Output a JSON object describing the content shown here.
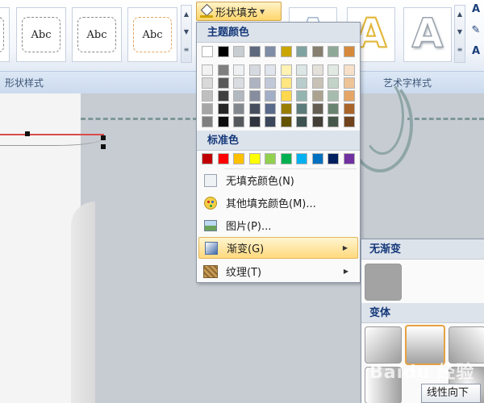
{
  "ribbon": {
    "shape_styles_label": "形状样式",
    "wordart_styles_label": "艺术字样式",
    "shape_fill_label": "形状填充",
    "style_sample_text": "Abc",
    "wordart_glyph": "A",
    "right_tool_glyphs": [
      "A",
      "✎",
      "A"
    ]
  },
  "menu": {
    "theme_colors_header": "主题颜色",
    "standard_colors_header": "标准色",
    "theme_top_row": [
      "#ffffff",
      "#000000",
      "#c8cdd2",
      "#5f6a7e",
      "#7e8ca6",
      "#c9a600",
      "#7fa3a1",
      "#877f6f",
      "#8ea896",
      "#d6893c"
    ],
    "theme_shades": [
      [
        "#f2f2f2",
        "#7f7f7f",
        "#eef0f2",
        "#d6d9df",
        "#e0e4ed",
        "#fff2b3",
        "#dbe6e5",
        "#e3e0da",
        "#e1e9e3",
        "#f6e0c9"
      ],
      [
        "#d9d9d9",
        "#595959",
        "#d9dde1",
        "#adb3c0",
        "#c1c9d9",
        "#ffe680",
        "#b8cdcb",
        "#c7c2b5",
        "#c3d3c8",
        "#eec397"
      ],
      [
        "#bfbfbf",
        "#3f3f3f",
        "#b1b8bf",
        "#858d9f",
        "#a2adc6",
        "#ffd84d",
        "#94b4b1",
        "#aba390",
        "#a6bdad",
        "#e5a566"
      ],
      [
        "#a6a6a6",
        "#262626",
        "#83888e",
        "#474e5e",
        "#5a6a8a",
        "#977d00",
        "#5b7c7a",
        "#655f53",
        "#698470",
        "#a9652a"
      ],
      [
        "#7f7f7f",
        "#0d0d0d",
        "#55595e",
        "#30343f",
        "#3c475c",
        "#645300",
        "#3d5251",
        "#433f37",
        "#465849",
        "#70431c"
      ]
    ],
    "standard_colors": [
      "#c00000",
      "#ff0000",
      "#ffc000",
      "#ffff00",
      "#92d050",
      "#00b050",
      "#00b0f0",
      "#0070c0",
      "#002060",
      "#7030a0"
    ],
    "items": [
      {
        "label": "无填充颜色(N)",
        "icon": "no-fill-icon"
      },
      {
        "label": "其他填充颜色(M)...",
        "icon": "palette-icon"
      },
      {
        "label": "图片(P)...",
        "icon": "picture-icon"
      },
      {
        "label": "渐变(G)",
        "icon": "gradient-icon"
      },
      {
        "label": "纹理(T)",
        "icon": "texture-icon"
      }
    ]
  },
  "submenu": {
    "no_gradient_header": "无渐变",
    "variants_header": "变体",
    "tooltip": "线性向下"
  },
  "watermark": "Baidu 经验"
}
